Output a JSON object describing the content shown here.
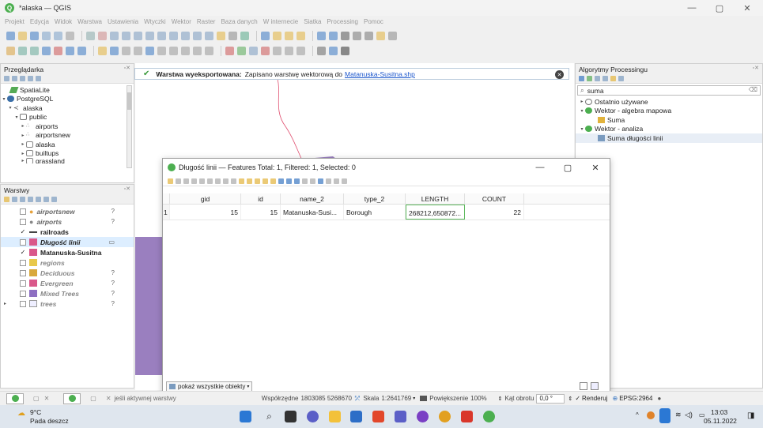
{
  "window": {
    "title": "*alaska — QGIS",
    "min": "—",
    "max": "▢",
    "close": "✕"
  },
  "menu": [
    "Projekt",
    "Edycja",
    "Widok",
    "Warstwa",
    "Ustawienia",
    "Wtyczki",
    "Wektor",
    "Raster",
    "Baza danych",
    "W internecie",
    "Siatka",
    "Processing",
    "Pomoc"
  ],
  "browser": {
    "title": "Przeglądarka",
    "items": [
      {
        "label": "SpatiaLite",
        "arrow": "",
        "indent": 4
      },
      {
        "label": "PostgreSQL",
        "arrow": "▾",
        "indent": 0
      },
      {
        "label": "alaska",
        "arrow": "▾",
        "indent": 8
      },
      {
        "label": "public",
        "arrow": "▾",
        "indent": 16
      },
      {
        "label": "airports",
        "arrow": "▸",
        "indent": 24
      },
      {
        "label": "airportsnew",
        "arrow": "▸",
        "indent": 24
      },
      {
        "label": "alaska",
        "arrow": "▸",
        "indent": 24
      },
      {
        "label": "builtups",
        "arrow": "▸",
        "indent": 24
      },
      {
        "label": "grassland",
        "arrow": "▸",
        "indent": 24
      }
    ]
  },
  "layers": {
    "title": "Warstwy",
    "items": [
      {
        "label": "airportsnew",
        "checked": "",
        "swatch": "#e6a23c",
        "style": "italic-bold",
        "q": "?"
      },
      {
        "label": "airports",
        "checked": "",
        "swatch": "#e6a23c",
        "style": "italic-bold",
        "q": "?"
      },
      {
        "label": "railroads",
        "checked": "✓",
        "swatch": "#444",
        "style": "bold",
        "q": ""
      },
      {
        "label": "Długość linii",
        "checked": "",
        "swatch": "#d9588a",
        "style": "italic-bold",
        "q": "▭"
      },
      {
        "label": "Matanuska-Susitna",
        "checked": "✓",
        "swatch": "#d9588a",
        "style": "bold",
        "q": ""
      },
      {
        "label": "regions",
        "checked": "",
        "swatch": "#e8c84a",
        "style": "italic-grey",
        "q": ""
      },
      {
        "label": "Deciduous",
        "checked": "",
        "swatch": "#d8a83c",
        "style": "italic-grey",
        "q": "?"
      },
      {
        "label": "Evergreen",
        "checked": "",
        "swatch": "#d9588a",
        "style": "italic-grey",
        "q": "?"
      },
      {
        "label": "Mixed Trees",
        "checked": "",
        "swatch": "#8e6fc2",
        "style": "italic-grey",
        "q": "?"
      },
      {
        "label": "trees",
        "checked": "",
        "swatch": "#cfd6e0",
        "style": "italic-grey",
        "q": "?"
      }
    ]
  },
  "message": {
    "bold": "Warstwa wyeksportowana:",
    "text": "Zapisano warstwę wektorową do",
    "link": "Matanuska-Susitna.shp",
    "close": "✕"
  },
  "processing": {
    "title": "Algorytmy Processingu",
    "search": "suma",
    "items": [
      {
        "label": "Ostatnio używane",
        "arrow": "▸",
        "indent": 4
      },
      {
        "label": "Wektor - algebra mapowa",
        "arrow": "▾",
        "indent": 4
      },
      {
        "label": "Suma",
        "arrow": "",
        "indent": 28
      },
      {
        "label": "Wektor - analiza",
        "arrow": "▾",
        "indent": 4
      },
      {
        "label": "Suma długości linii",
        "arrow": "",
        "indent": 28
      }
    ]
  },
  "attr_table": {
    "title": "Długość linii — Features Total: 1, Filtered: 1, Selected: 0",
    "columns": [
      "gid",
      "id",
      "name_2",
      "type_2",
      "LENGTH",
      "COUNT"
    ],
    "rows": [
      {
        "num": "1",
        "gid": "15",
        "id": "15",
        "name_2": "Matanuska-Susi...",
        "type_2": "Borough",
        "length": "268212,650872...",
        "count": "22"
      }
    ],
    "show_all": "pokaż wszystkie obiekty"
  },
  "statusbar": {
    "locate": "jeśli aktywnej warstwy",
    "coord_label": "Współrzędne",
    "coord": "1803085 5268670",
    "scale_label": "Skala",
    "scale": "1:2641769",
    "zoom_label": "Powiększenie",
    "zoom": "100%",
    "rotation_label": "Kąt obrotu",
    "rotation": "0,0 °",
    "render": "Renderuj",
    "crs": "EPSG:2964"
  },
  "taskbar": {
    "temp": "9°C",
    "weather": "Pada deszcz",
    "time": "13:03",
    "date": "05.11.2022"
  }
}
